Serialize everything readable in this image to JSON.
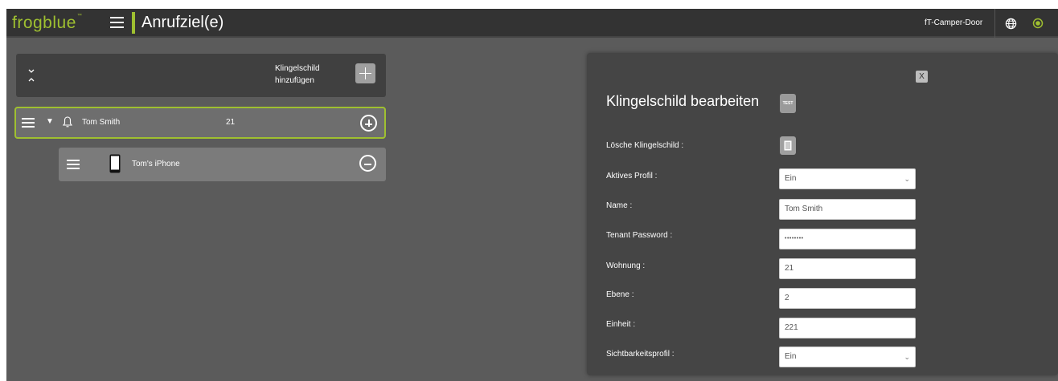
{
  "header": {
    "logo": "frogblue",
    "logo_mark": "™",
    "title": "Anrufziel(e)",
    "device": "fT-Camper-Door"
  },
  "left": {
    "add_label_line1": "Klingelschild",
    "add_label_line2": "hinzufügen",
    "doorbell": {
      "name": "Tom Smith",
      "number": "21"
    },
    "device": {
      "name": "Tom's iPhone"
    }
  },
  "panel": {
    "close": "X",
    "title": "Klingelschild bearbeiten",
    "test_label": "TEST",
    "fields": {
      "delete_label": "Lösche Klingelschild :",
      "profile_label": "Aktives Profil :",
      "profile_value": "Ein",
      "name_label": "Name :",
      "name_value": "Tom Smith",
      "password_label": "Tenant Password :",
      "password_value": "••••••••",
      "apartment_label": "Wohnung :",
      "apartment_value": "21",
      "level_label": "Ebene :",
      "level_value": "2",
      "unit_label": "Einheit :",
      "unit_value": "221",
      "visibility_label": "Sichtbarkeitsprofil :",
      "visibility_value": "Ein"
    }
  },
  "colors": {
    "brand_green": "#9fc030",
    "background": "#5b5b5b",
    "topbar": "#333333",
    "panel": "#454545"
  }
}
